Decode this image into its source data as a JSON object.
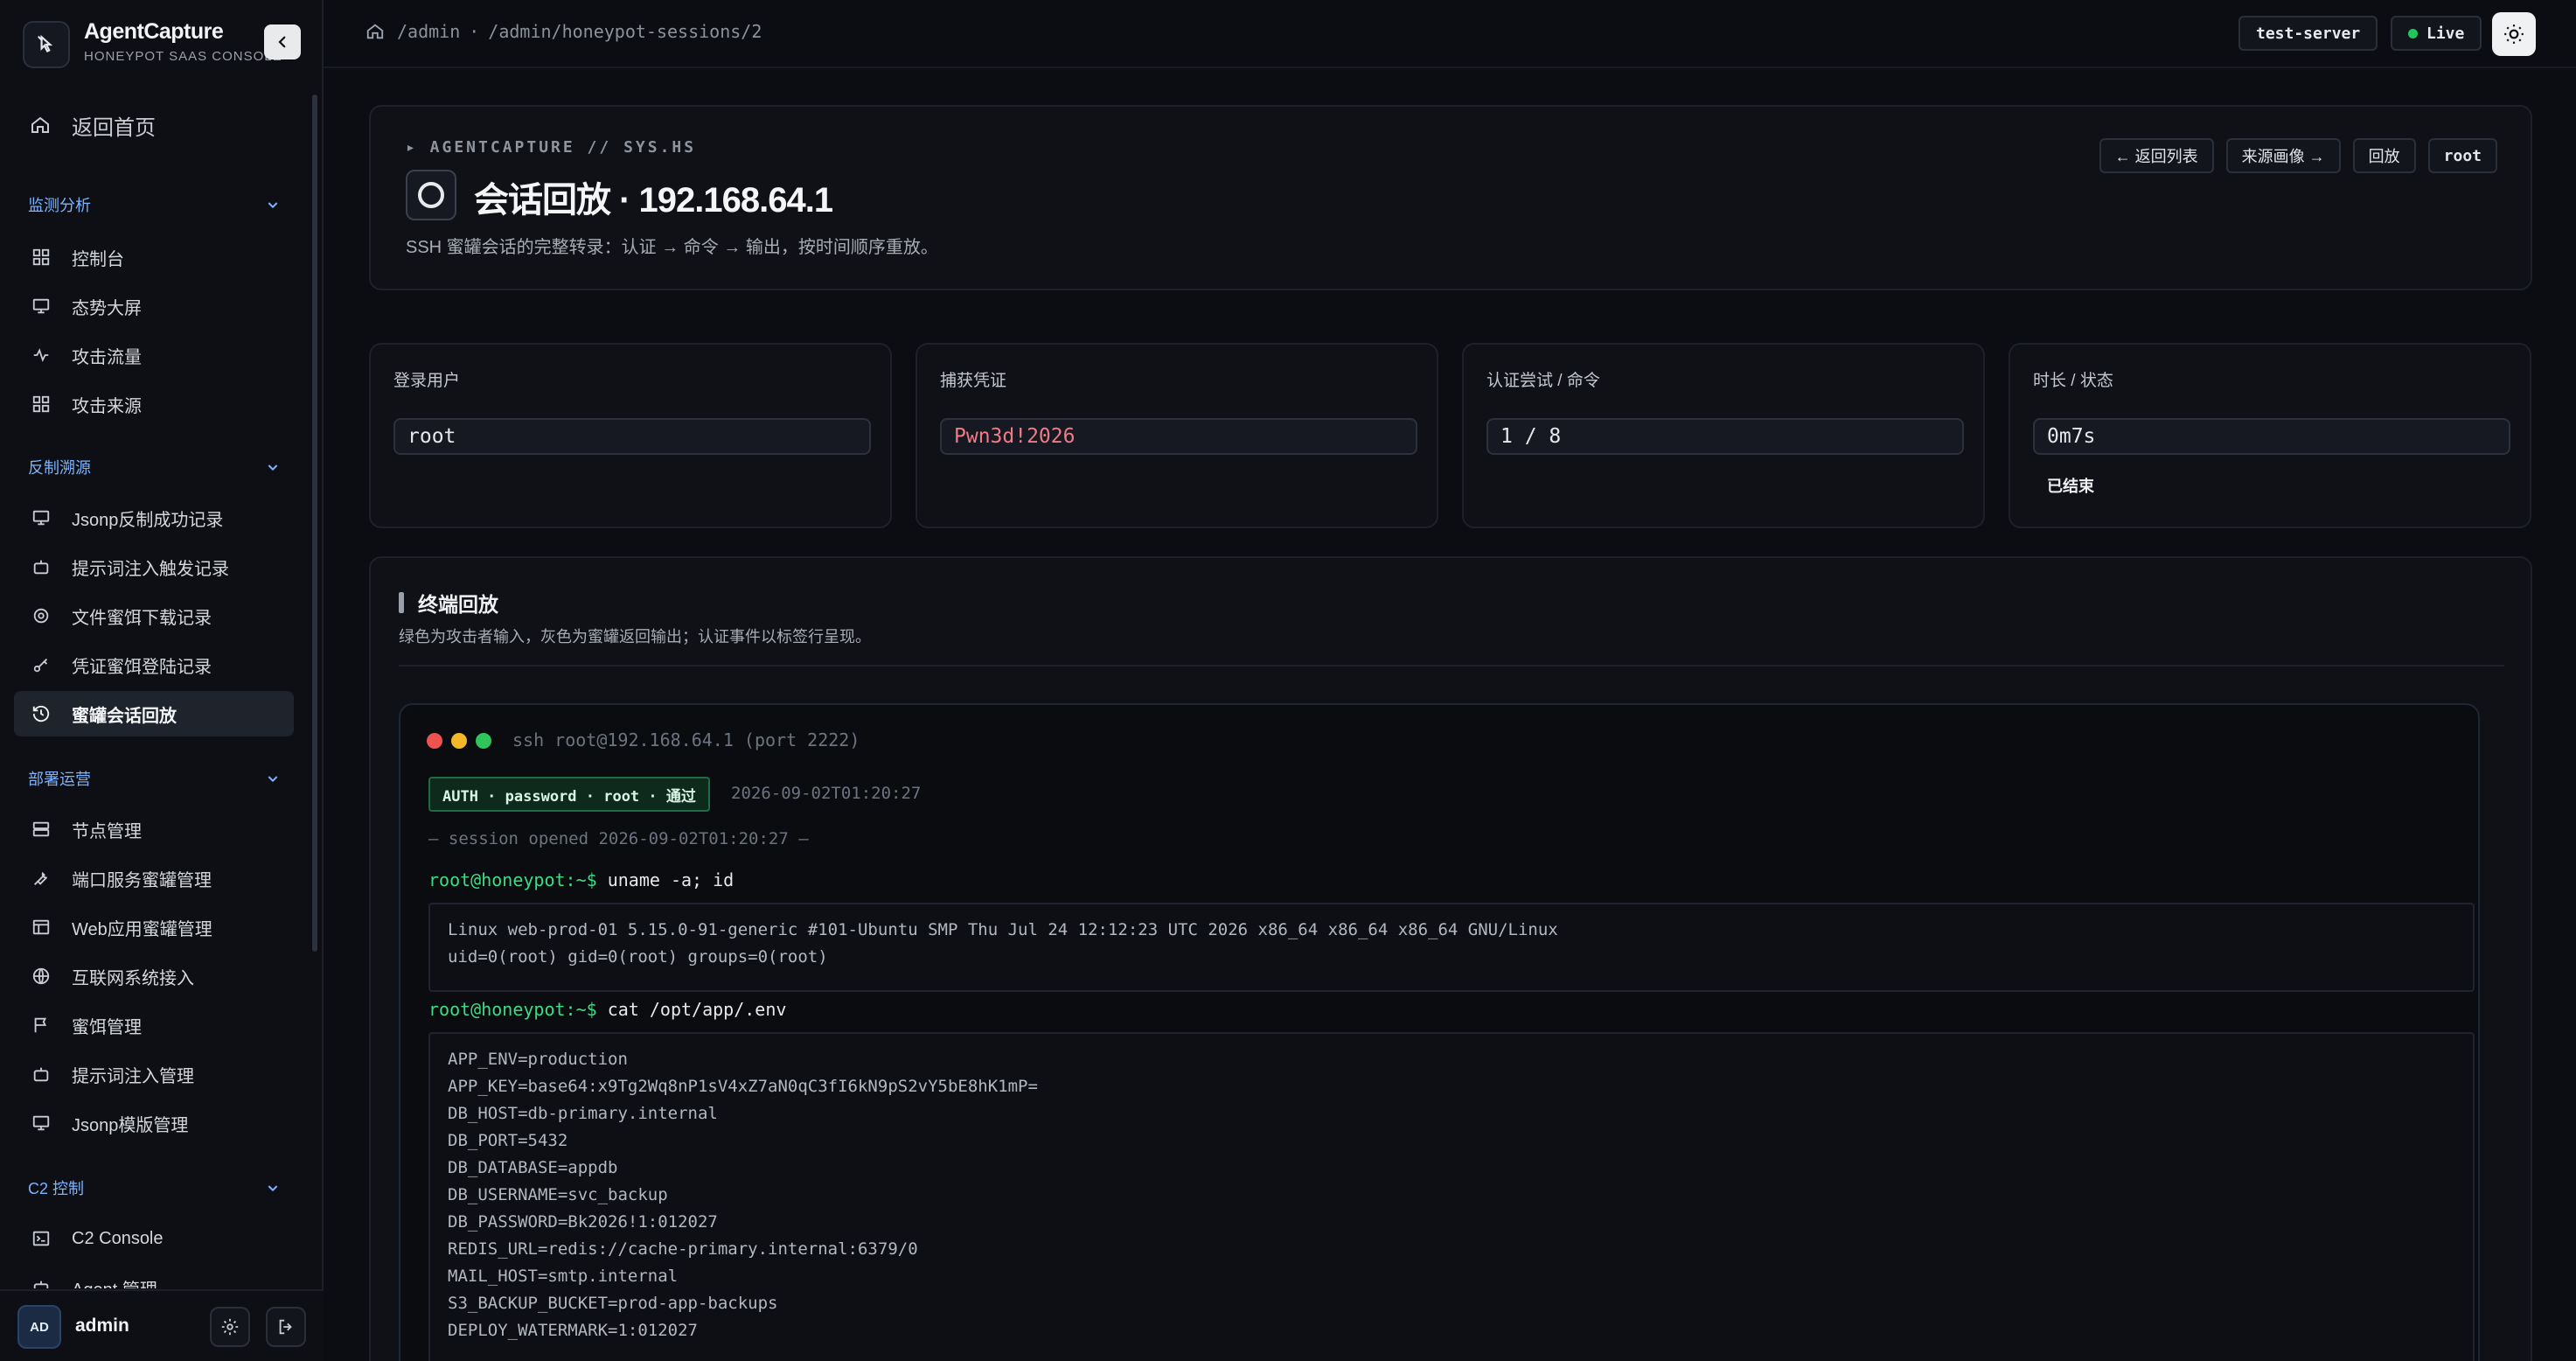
{
  "brand": {
    "title": "AgentCapture",
    "subtitle": "HONEYPOT SAAS CONSOLE"
  },
  "nav": {
    "home": "返回首页",
    "groups": [
      {
        "title": "监测分析",
        "items": [
          "控制台",
          "态势大屏",
          "攻击流量",
          "攻击来源"
        ]
      },
      {
        "title": "反制溯源",
        "items": [
          "Jsonp反制成功记录",
          "提示词注入触发记录",
          "文件蜜饵下载记录",
          "凭证蜜饵登陆记录",
          "蜜罐会话回放"
        ]
      },
      {
        "title": "部署运营",
        "items": [
          "节点管理",
          "端口服务蜜罐管理",
          "Web应用蜜罐管理",
          "互联网系统接入",
          "蜜饵管理",
          "提示词注入管理",
          "Jsonp模版管理"
        ]
      },
      {
        "title": "C2 控制",
        "items": [
          "C2 Console",
          "Agent 管理"
        ]
      }
    ]
  },
  "user": {
    "initials": "AD",
    "name": "admin"
  },
  "topbar": {
    "crumb_1": "/admin",
    "crumb_sep": "·",
    "crumb_2": "/admin/honeypot-sessions/2",
    "server": "test-server",
    "live": "Live"
  },
  "hero": {
    "kicker": "▸ AGENTCAPTURE // SYS.HS",
    "title": "会话回放 · 192.168.64.1",
    "desc": "SSH 蜜罐会话的完整转录：认证 → 命令 → 输出，按时间顺序重放。",
    "actions": [
      "← 返回列表",
      "来源画像 →",
      "回放",
      "root"
    ]
  },
  "stats": [
    {
      "label": "登录用户",
      "value": "root",
      "extra": ""
    },
    {
      "label": "捕获凭证",
      "value": "Pwn3d!2026",
      "extra": ""
    },
    {
      "label": "认证尝试 / 命令",
      "value": "1 / 8",
      "extra": ""
    },
    {
      "label": "时长 / 状态",
      "value": "0m7s",
      "extra": "已结束"
    }
  ],
  "terminal": {
    "title": "终端回放",
    "desc": "绿色为攻击者输入，灰色为蜜罐返回输出；认证事件以标签行呈现。",
    "header": "ssh root@192.168.64.1 (port 2222)",
    "auth_badge": "AUTH · password · root · 通过",
    "auth_time": "2026-09-02T01:20:27",
    "session_opened": "— session opened 2026-09-02T01:20:27 —",
    "prompt": "root@honeypot:~$",
    "cmd_1": "uname -a; id",
    "out_1": [
      "Linux web-prod-01 5.15.0-91-generic #101-Ubuntu SMP Thu Jul 24 12:12:23 UTC 2026 x86_64 x86_64 x86_64 GNU/Linux",
      "uid=0(root) gid=0(root) groups=0(root)"
    ],
    "cmd_2": "cat /opt/app/.env",
    "out_2": [
      "APP_ENV=production",
      "APP_KEY=base64:x9Tg2Wq8nP1sV4xZ7aN0qC3fI6kN9pS2vY5bE8hK1mP=",
      "DB_HOST=db-primary.internal",
      "DB_PORT=5432",
      "DB_DATABASE=appdb",
      "DB_USERNAME=svc_backup",
      "DB_PASSWORD=Bk2026!1:012027",
      "REDIS_URL=redis://cache-primary.internal:6379/0",
      "MAIL_HOST=smtp.internal",
      "S3_BACKUP_BUCKET=prod-app-backups",
      "DEPLOY_WATERMARK=1:012027"
    ]
  },
  "colors": {
    "accent": "#7bb3ff",
    "live": "#22c55e",
    "prompt": "#3ddc84",
    "credential": "#f07a86"
  }
}
